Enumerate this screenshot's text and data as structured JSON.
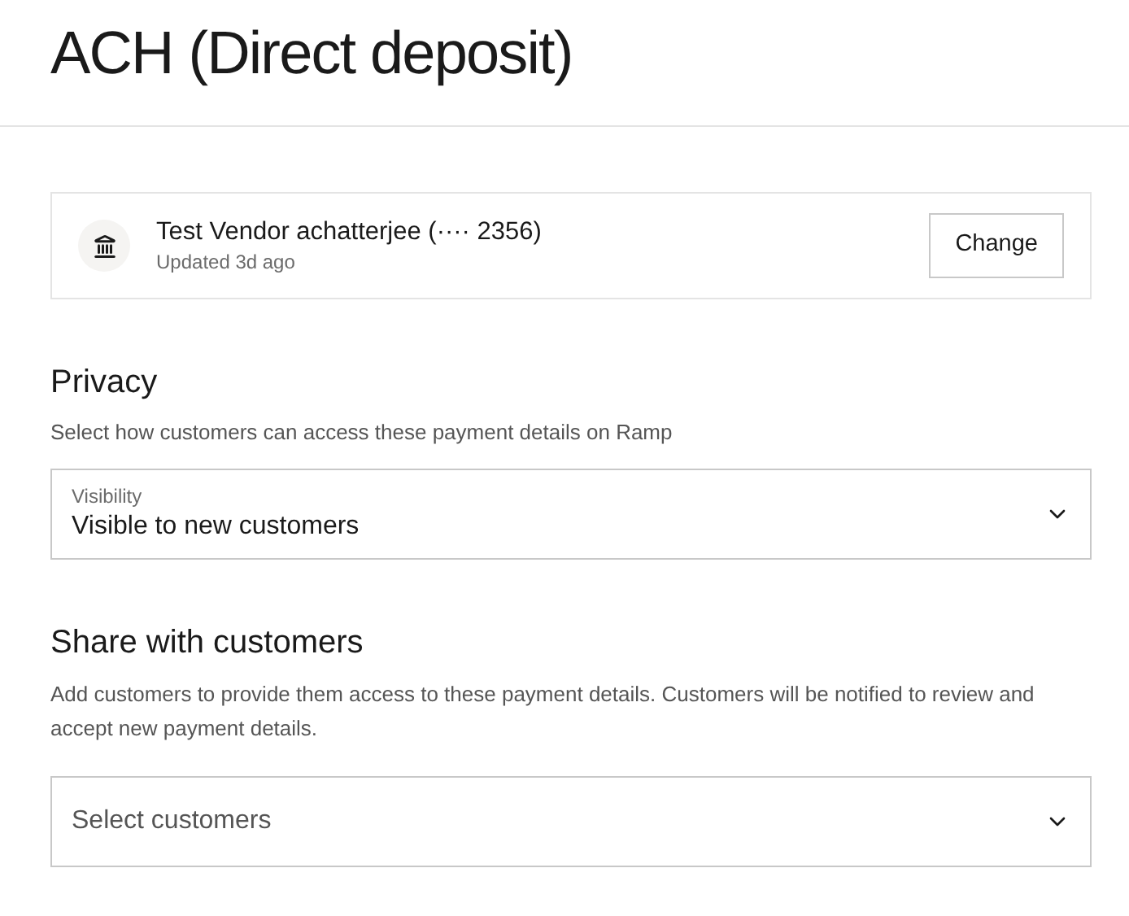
{
  "page_title": "ACH (Direct deposit)",
  "account": {
    "name": "Test Vendor achatterjee (···· 2356)",
    "updated": "Updated 3d ago",
    "button": "Change"
  },
  "privacy": {
    "heading": "Privacy",
    "description": "Select how customers can access these payment details on Ramp",
    "field": {
      "label": "Visibility",
      "value": "Visible to new customers"
    }
  },
  "share": {
    "heading": "Share with customers",
    "description": "Add customers to provide them access to these payment details. Customers will be notified to review and accept new payment details.",
    "field": {
      "placeholder": "Select customers"
    }
  }
}
